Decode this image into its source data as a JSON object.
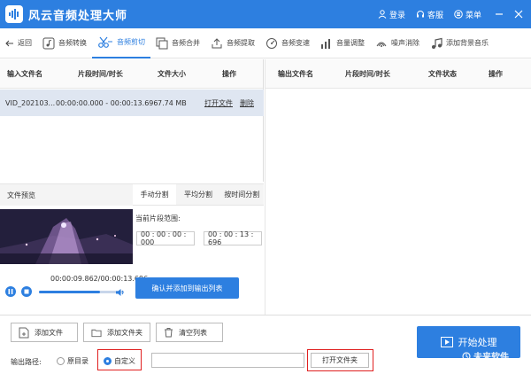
{
  "titlebar": {
    "title": "风云音频处理大师",
    "login": "登录",
    "service": "客服",
    "menu": "菜单"
  },
  "toolbar": {
    "back": "返回",
    "items": [
      "音频转换",
      "音频剪切",
      "音频合并",
      "音频提取",
      "音频变速",
      "音量调整",
      "噪声消除",
      "添加背景音乐"
    ]
  },
  "input_table": {
    "headers": [
      "输入文件名",
      "片段时间/时长",
      "文件大小",
      "操作"
    ],
    "rows": [
      {
        "name": "VID_202103...",
        "time": "00:00:00.000 - 00:00:13.696",
        "size": "7.74 MB",
        "open": "打开文件",
        "delete": "删除"
      }
    ]
  },
  "output_table": {
    "headers": [
      "输出文件名",
      "片段时间/时长",
      "文件状态",
      "操作"
    ]
  },
  "preview": {
    "label": "文件预览",
    "playback_time": "00:00:09.862/00:00:13.696",
    "progress": 0.72
  },
  "split_tabs": [
    "手动分割",
    "平均分割",
    "按时间分割"
  ],
  "segment": {
    "label": "当前片段范围:",
    "start": "00 : 00 : 00 : 000",
    "end": "00 : 00 : 13 : 696",
    "confirm": "确认并添加到输出列表"
  },
  "bottom": {
    "add_file": "添加文件",
    "add_folder": "添加文件夹",
    "clear_list": "清空列表",
    "output_path_label": "输出路径:",
    "opt_original": "原目录",
    "opt_custom": "自定义",
    "path_value": "",
    "open_folder": "打开文件夹",
    "start": "开始处理",
    "watermark": "未来软件"
  },
  "colors": {
    "accent": "#2d7fe0",
    "highlight": "#e02020",
    "selected_row": "#dfe6f1"
  }
}
